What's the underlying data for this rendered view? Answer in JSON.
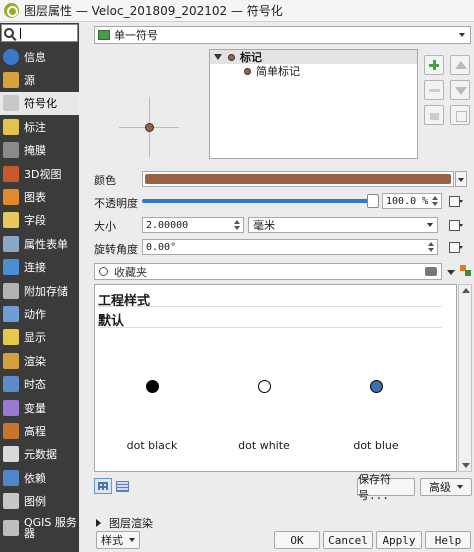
{
  "window": {
    "title": "图层属性 — Veloc_201809_202102 — 符号化"
  },
  "sidebar": {
    "search_value": "",
    "items": [
      {
        "label": "信息",
        "icon": "info-icon",
        "color": "#3a78c9"
      },
      {
        "label": "源",
        "icon": "source-icon",
        "color": "#d8a13a"
      },
      {
        "label": "符号化",
        "icon": "paintbrush-icon",
        "color": "#c8c8c8"
      },
      {
        "label": "标注",
        "icon": "label-abc-icon",
        "color": "#e3c34a"
      },
      {
        "label": "掩膜",
        "icon": "mask-abc-icon",
        "color": "#8a8a8a"
      },
      {
        "label": "3D视图",
        "icon": "cube-3d-icon",
        "color": "#c65a2c"
      },
      {
        "label": "图表",
        "icon": "diagram-icon",
        "color": "#e08a2a"
      },
      {
        "label": "字段",
        "icon": "fields-icon",
        "color": "#e9c75b"
      },
      {
        "label": "属性表单",
        "icon": "form-icon",
        "color": "#8fa7c7"
      },
      {
        "label": "连接",
        "icon": "join-icon",
        "color": "#4a8fd1"
      },
      {
        "label": "附加存储",
        "icon": "storage-icon",
        "color": "#b3b3b3"
      },
      {
        "label": "动作",
        "icon": "action-gear-icon",
        "color": "#6f9ed6"
      },
      {
        "label": "显示",
        "icon": "display-bubble-icon",
        "color": "#e6c84d"
      },
      {
        "label": "渲染",
        "icon": "render-brush-icon",
        "color": "#d4a13d"
      },
      {
        "label": "时态",
        "icon": "clock-icon",
        "color": "#5d8cc9"
      },
      {
        "label": "变量",
        "icon": "variable-icon",
        "color": "#9a7ad0"
      },
      {
        "label": "高程",
        "icon": "elevation-icon",
        "color": "#c9742c"
      },
      {
        "label": "元数据",
        "icon": "metadata-icon",
        "color": "#d9d9d9"
      },
      {
        "label": "依赖",
        "icon": "dependency-icon",
        "color": "#4f86c9"
      },
      {
        "label": "图例",
        "icon": "legend-icon",
        "color": "#c7c7c7"
      },
      {
        "label": "QGIS 服务器",
        "icon": "server-icon",
        "color": "#bdbdbd"
      }
    ],
    "active_index": 2
  },
  "symbology": {
    "renderer": "单一符号",
    "tree": {
      "root": "标记",
      "child": "简单标记"
    },
    "fields": {
      "color_label": "颜色",
      "color_value": "#9b6145",
      "opacity_label": "不透明度",
      "opacity_value": "100.0 %",
      "opacity_fraction": 1.0,
      "size_label": "大小",
      "size_value": "2.00000",
      "size_unit": "毫米",
      "rotation_label": "旋转角度",
      "rotation_value": "0.00°"
    },
    "library": {
      "search_placeholder": "收藏夹",
      "groups": [
        "工程样式",
        "默认"
      ],
      "symbols": [
        {
          "label": "dot  black",
          "fill": "#000000"
        },
        {
          "label": "dot  white",
          "fill": "#ffffff"
        },
        {
          "label": "dot blue",
          "fill": "#3d6fb0"
        }
      ]
    },
    "buttons": {
      "save_symbol": "保存符号...",
      "advanced": "高级"
    },
    "layer_rendering": "图层渲染"
  },
  "footer": {
    "style": "样式",
    "ok": "OK",
    "cancel": "Cancel",
    "apply": "Apply",
    "help": "Help"
  }
}
